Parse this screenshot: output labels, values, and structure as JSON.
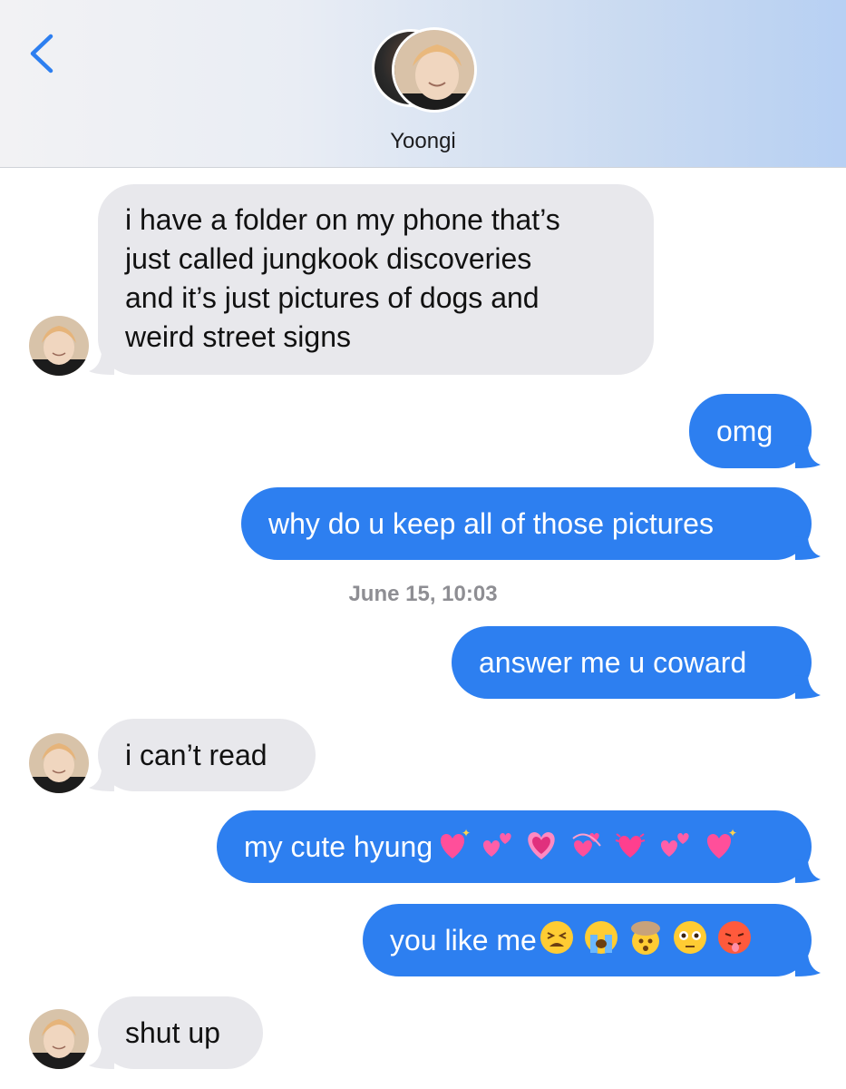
{
  "header": {
    "contact_name": "Yoongi"
  },
  "messages": [
    {
      "id": "m1",
      "direction": "incoming",
      "lines": [
        "i have a folder on my phone that’s",
        "just called jungkook discoveries",
        "and it’s just pictures of dogs and",
        "weird street signs"
      ]
    },
    {
      "id": "m2",
      "direction": "outgoing",
      "text": "omg"
    },
    {
      "id": "m3",
      "direction": "outgoing",
      "text": "why do u keep all of those pictures"
    },
    {
      "id": "m4",
      "direction": "outgoing",
      "text": "answer me u coward"
    },
    {
      "id": "m5",
      "direction": "incoming",
      "text": "i can’t read"
    },
    {
      "id": "m6",
      "direction": "outgoing",
      "text": "my cute hyung",
      "emojis": [
        "sparkling-heart",
        "two-hearts",
        "growing-heart",
        "revolving-hearts",
        "beating-heart",
        "two-hearts",
        "sparkling-heart"
      ]
    },
    {
      "id": "m7",
      "direction": "outgoing",
      "text": "you like me",
      "emojis": [
        "tired-face",
        "loudly-crying-face",
        "exploding-head",
        "flushed-face",
        "hot-face"
      ]
    },
    {
      "id": "m8",
      "direction": "incoming",
      "text": "shut up"
    }
  ],
  "timestamp": "June 15, 10:03",
  "colors": {
    "outgoing_bubble": "#2d7ff0",
    "incoming_bubble": "#e8e8ec",
    "back_chevron": "#2d7ff0",
    "timestamp": "#8e8e93"
  }
}
